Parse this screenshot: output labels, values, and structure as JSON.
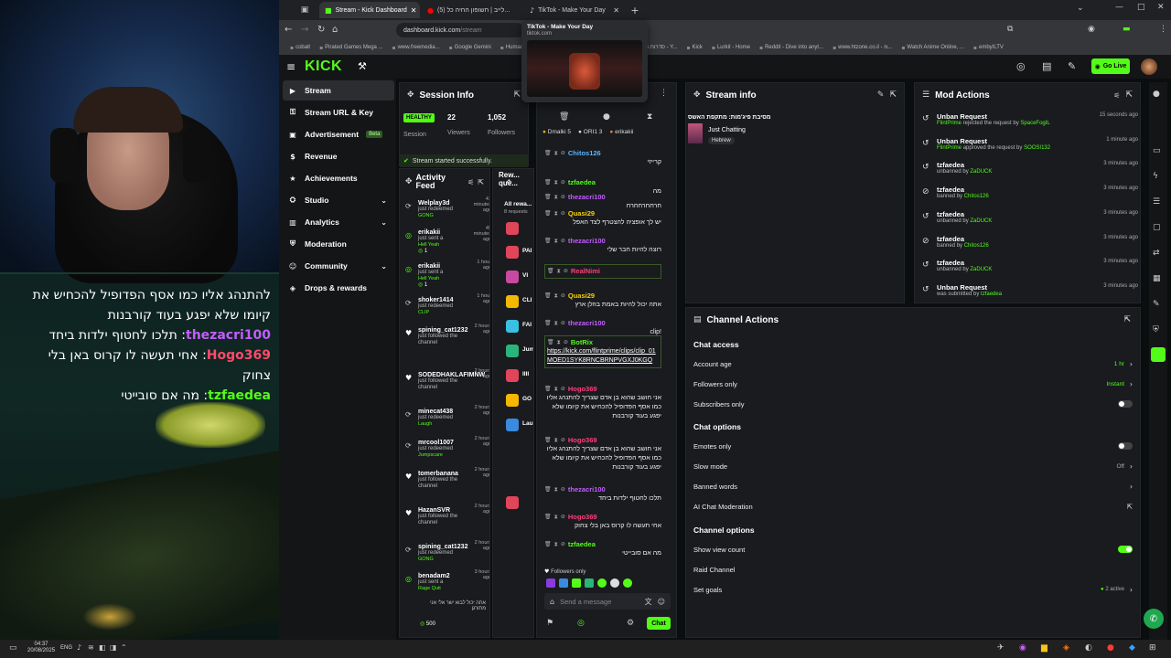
{
  "overlay": {
    "chat_lines": [
      {
        "user": "",
        "text": "להתנהג אליו כמו אסף הפדופיל להכחיש את"
      },
      {
        "user": "",
        "text": "קיומו שלא יפגע בעוד קורבנות"
      },
      {
        "user": "thezacri100",
        "text": "תלכו לחטוף ילדות ביחד"
      },
      {
        "user": "Hogo369",
        "text": "אחי תעשה לו קרוס באן בלי"
      },
      {
        "user": "",
        "text": "צחוק"
      },
      {
        "user": "tzfaedea",
        "text": "מה אם סובייטי"
      }
    ]
  },
  "browser": {
    "tabs": [
      {
        "label": "Stream - Kick Dashboard",
        "active": true
      },
      {
        "label": "(5) לייב | חשופון החיה כל...",
        "active": false
      },
      {
        "label": "TikTok - Make Your Day",
        "active": false
      }
    ],
    "tooltip_title": "TikTok - Make Your Day",
    "tooltip_url": "tiktok.com",
    "url_domain": "dashboard.kick.com",
    "url_path": "/stream",
    "bookmarks": [
      "cobalt",
      "Pirated Games Mega ...",
      "www.freemedia...",
      "Google Gemini",
      "Humanize AI",
      "Flint - YouTube",
      "סדרות מדבובות בעברית חי - Y...",
      "Kick",
      "Lurkit - Home",
      "Reddit - Dive into anyt...",
      "www.htzone.co.il - מ...",
      "Watch Anime Online, ...",
      "embyILTV"
    ]
  },
  "kick": {
    "logo": "KICK",
    "go_live": "Go Live"
  },
  "sidebar": {
    "items": [
      {
        "label": "Stream",
        "active": true
      },
      {
        "label": "Stream URL & Key"
      },
      {
        "label": "Advertisement",
        "badge": "Beta"
      },
      {
        "label": "Revenue"
      },
      {
        "label": "Achievements"
      },
      {
        "label": "Studio",
        "chevron": true
      },
      {
        "label": "Analytics",
        "chevron": true
      },
      {
        "label": "Moderation"
      },
      {
        "label": "Community",
        "chevron": true
      },
      {
        "label": "Drops & rewards"
      }
    ]
  },
  "session": {
    "title": "Session Info",
    "status": "HEALTHY",
    "status_label": "Session",
    "viewers": "22",
    "viewers_label": "Viewers",
    "followers": "1,052",
    "followers_label": "Followers",
    "toast": "Stream started successfully."
  },
  "activity": {
    "title": "Activity Feed",
    "items": [
      {
        "name": "Welplay3d",
        "time": "41 minutes ago",
        "sub": "just redeemed",
        "tag": "GONG",
        "icon": "redeem"
      },
      {
        "name": "erikakii",
        "time": "49 minutes ago",
        "sub": "just sent a",
        "tag": "Hell Yeah",
        "icon": "kick",
        "count": "1"
      },
      {
        "name": "erikakii",
        "time": "1 hour ago",
        "sub": "just sent a",
        "tag": "Hell Yeah",
        "icon": "kick",
        "count": "1"
      },
      {
        "name": "shoker1414",
        "time": "1 hour ago",
        "sub": "just redeemed",
        "tag": "CLIP",
        "icon": "redeem"
      },
      {
        "name": "spining_cat1232",
        "time": "2 hours ago",
        "sub": "just followed the channel",
        "tag": "",
        "icon": "heart"
      },
      {
        "name": "SODEDHAKLAFIMNW",
        "time": "2 hours ago",
        "sub": "just followed the channel",
        "tag": "",
        "icon": "heart"
      },
      {
        "name": "minecat438",
        "time": "2 hours ago",
        "sub": "just redeemed",
        "tag": "Laugh",
        "icon": "redeem"
      },
      {
        "name": "mrcool1007",
        "time": "2 hours ago",
        "sub": "just redeemed",
        "tag": "Jumpscare",
        "icon": "redeem"
      },
      {
        "name": "tomerbanana",
        "time": "2 hours ago",
        "sub": "just followed the channel",
        "tag": "",
        "icon": "heart"
      },
      {
        "name": "HazanSVR",
        "time": "2 hours ago",
        "sub": "just followed the channel",
        "tag": "",
        "icon": "heart"
      },
      {
        "name": "spining_cat1232",
        "time": "2 hours ago",
        "sub": "just redeemed",
        "tag": "GONG",
        "icon": "redeem"
      },
      {
        "name": "benadam2",
        "time": "3 hours ago",
        "sub": "just sent a",
        "tag": "Rage Quit",
        "icon": "kick"
      }
    ],
    "last_quote": "אתה יכול לבוא ישר אלי אני מתורגן",
    "last_amount": "500"
  },
  "rewards": {
    "title": "Rew... que...",
    "all_label": "All rewa...",
    "requests": "8 requests",
    "items": [
      "PAI",
      "VI",
      "CLI",
      "FAI",
      "Jum",
      "IIII",
      "GO",
      "Lau"
    ]
  },
  "chat": {
    "chips": [
      "Dmalki 5",
      "ORI1 3",
      "erikakii"
    ],
    "lines": [
      {
        "user": "Chitos126",
        "text": "קרייזי",
        "color": "#5ab4ff"
      },
      {
        "user": "tzfaedea",
        "text": "מה",
        "color": "#53fc18"
      },
      {
        "user": "thezacri100",
        "text": "חרחחרחחרח",
        "color": "#c45cff"
      },
      {
        "user": "Quasi29",
        "text": "יש לך אופציה להצטרף לצד האפל",
        "color": "#f5d000"
      },
      {
        "user": "thezacri100",
        "text": "רוצה להיות חבר שלי",
        "color": "#c45cff"
      },
      {
        "user": "RealNimi",
        "text": "",
        "color": "#ff3e7a"
      },
      {
        "user": "Quasi29",
        "text": "אתה יכול להיות באמת בוזלן ארץ",
        "color": "#f5d000"
      },
      {
        "user": "thezacri100",
        "text": "!clip",
        "color": "#c45cff"
      },
      {
        "user": "BotRix",
        "text": "https://kick.com/flintprime/clips/clip_01MOED1SYK8RNCBRNPVGXJ0KGQ",
        "color": "#53fc18"
      },
      {
        "user": "Hogo369",
        "text": "אני חושב שהוא בן אדם שצריך להתנהג אליו כמו אסף הפדופיל להכחיש את קיומו שלא יפגע בעוד קורבנות",
        "color": "#ff3e7a"
      },
      {
        "user": "Hogo369",
        "text": "אני חושב שהוא בן אדם שצריך להתנהג אליו כמו אסף הפדופיל להכחיש את קיומו שלא יפגע בעוד קורבנות",
        "color": "#ff3e7a"
      },
      {
        "user": "thezacri100",
        "text": "תלכו לחטוף ילדות ביחד",
        "color": "#c45cff"
      },
      {
        "user": "Hogo369",
        "text": "אחי תעשה לו קרוס באן בלי צחוק",
        "color": "#ff3e7a"
      },
      {
        "user": "tzfaedea",
        "text": "מה אם סובייטי",
        "color": "#53fc18"
      }
    ],
    "followers_only": "Followers only",
    "placeholder": "Send a message",
    "send": "Chat"
  },
  "stream_info": {
    "title": "Stream info",
    "stream_title": "מסיבת פיג'מות: מתקפת האשס",
    "category": "Just Chatting",
    "tag": "Hebrew"
  },
  "mod_actions": {
    "title": "Mod Actions",
    "rows": [
      {
        "title": "Unban Request",
        "actor": "FlintPrime",
        "verb": "rejected the request by",
        "target": "SpaceFogIL",
        "time": "15 seconds ago",
        "icon": "undo"
      },
      {
        "title": "Unban Request",
        "actor": "FlintPrime",
        "verb": "approved the request by",
        "target": "SOOSI132",
        "time": "1 minute ago",
        "icon": "undo"
      },
      {
        "title": "tzfaedea",
        "actor": "",
        "verb": "unbanned by",
        "target": "ZaDUCK",
        "time": "3 minutes ago",
        "icon": "undo"
      },
      {
        "title": "tzfaedea",
        "actor": "",
        "verb": "banned by",
        "target": "Chitos126",
        "time": "3 minutes ago",
        "icon": "ban"
      },
      {
        "title": "tzfaedea",
        "actor": "",
        "verb": "unbanned by",
        "target": "ZaDUCK",
        "time": "3 minutes ago",
        "icon": "undo"
      },
      {
        "title": "tzfaedea",
        "actor": "",
        "verb": "banned by",
        "target": "Chitos126",
        "time": "3 minutes ago",
        "icon": "ban"
      },
      {
        "title": "tzfaedea",
        "actor": "",
        "verb": "unbanned by",
        "target": "ZaDUCK",
        "time": "3 minutes ago",
        "icon": "undo"
      },
      {
        "title": "Unban Request",
        "actor": "",
        "verb": "was submitted by",
        "target": "tzfaedea",
        "time": "3 minutes ago",
        "icon": "undo"
      }
    ]
  },
  "channel_actions": {
    "title": "Channel Actions",
    "chat_access": "Chat access",
    "account_age": "Account age",
    "account_age_val": "1 hr",
    "followers_only": "Followers only",
    "followers_only_val": "Instant",
    "subscribers_only": "Subscribers only",
    "chat_options": "Chat options",
    "emotes_only": "Emotes only",
    "slow_mode": "Slow mode",
    "slow_mode_val": "Off",
    "banned_words": "Banned words",
    "ai_mod": "AI Chat Moderation",
    "channel_options": "Channel options",
    "show_view_count": "Show view count",
    "raid_channel": "Raid Channel",
    "set_goals": "Set goals",
    "set_goals_val": "2 active"
  },
  "taskbar": {
    "time": "04:37",
    "date": "20/08/2025",
    "lang": "ENG"
  }
}
